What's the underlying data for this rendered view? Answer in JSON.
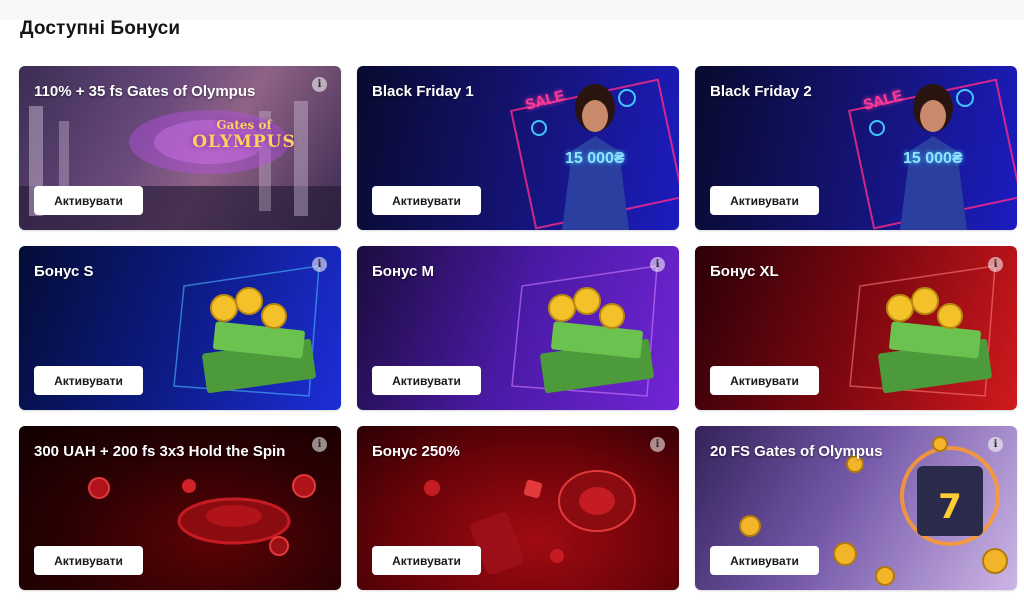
{
  "page": {
    "title": "Доступні Бонуси"
  },
  "common": {
    "activate_label": "Активувати",
    "info_glyph": "i"
  },
  "bonuses": [
    {
      "title": "110% + 35 fs Gates of Olympus",
      "art": "gates-of-olympus",
      "logo_line1": "Gates of",
      "logo_line2": "OLYMPUS"
    },
    {
      "title": "Black Friday 1",
      "art": "black-friday-sale",
      "sale_text": "SALE",
      "amount_text": "15 000₴"
    },
    {
      "title": "Black Friday 2",
      "art": "black-friday-sale",
      "sale_text": "SALE",
      "amount_text": "15 000₴"
    },
    {
      "title": "Бонус S",
      "art": "money-stack-blue"
    },
    {
      "title": "Бонус M",
      "art": "money-stack-purple"
    },
    {
      "title": "Бонус XL",
      "art": "money-stack-red"
    },
    {
      "title": "300 UAH + 200 fs 3x3 Hold the Spin",
      "art": "red-casino-chips"
    },
    {
      "title": "Бонус 250%",
      "art": "red-dice-roulette"
    },
    {
      "title": "20 FS Gates of Olympus",
      "art": "slot-coins"
    }
  ],
  "colors": {
    "button_bg": "#ffffff",
    "title_text": "#151515",
    "card_text": "#ffffff"
  }
}
